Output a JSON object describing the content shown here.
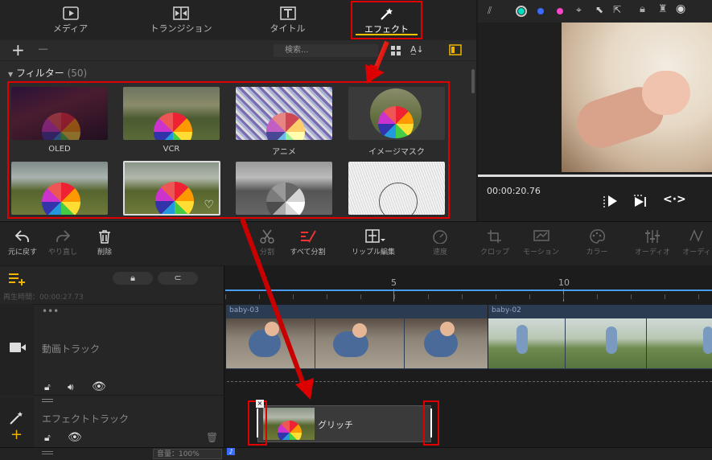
{
  "tabs": [
    {
      "label": "メディア",
      "icon": "media-icon"
    },
    {
      "label": "トランジション",
      "icon": "transition-icon"
    },
    {
      "label": "タイトル",
      "icon": "title-icon"
    },
    {
      "label": "エフェクト",
      "icon": "effect-wand-icon"
    }
  ],
  "search": {
    "placeholder": "検索..."
  },
  "filter_section": {
    "title": "フィルター",
    "count": "(50)"
  },
  "filters": [
    {
      "label": "OLED"
    },
    {
      "label": "VCR"
    },
    {
      "label": "アニメ"
    },
    {
      "label": "イメージマスク"
    },
    {
      "label": ""
    },
    {
      "label": ""
    },
    {
      "label": ""
    },
    {
      "label": ""
    }
  ],
  "preview": {
    "timecode": "00:00:20.76",
    "colors": [
      "#00e0c0",
      "#3a6cff",
      "#ff44cc"
    ]
  },
  "toolbar": [
    {
      "label": "元に戻す",
      "enabled": true
    },
    {
      "label": "やり直し",
      "enabled": false
    },
    {
      "label": "削除",
      "enabled": true
    },
    {
      "label": "分割",
      "enabled": false
    },
    {
      "label": "すべて分割",
      "enabled": true
    },
    {
      "label": "リップル編集",
      "enabled": true
    },
    {
      "label": "速度",
      "enabled": false
    },
    {
      "label": "クロップ",
      "enabled": false
    },
    {
      "label": "モーション",
      "enabled": false
    },
    {
      "label": "カラー",
      "enabled": false
    },
    {
      "label": "オーディオ",
      "enabled": false
    },
    {
      "label": "オーディ",
      "enabled": false
    }
  ],
  "timeline": {
    "playtime_label": "再生時間：",
    "playtime": "00:00:27.73",
    "ruler": [
      "5",
      "10"
    ]
  },
  "tracks": {
    "video": {
      "label": "動画トラック",
      "clips": [
        "baby-03",
        "baby-02"
      ]
    },
    "effect": {
      "label": "エフェクトトラック",
      "clip": "グリッチ"
    }
  },
  "volume": {
    "label": "音量：",
    "value": "100%"
  },
  "accent": "#e00000"
}
